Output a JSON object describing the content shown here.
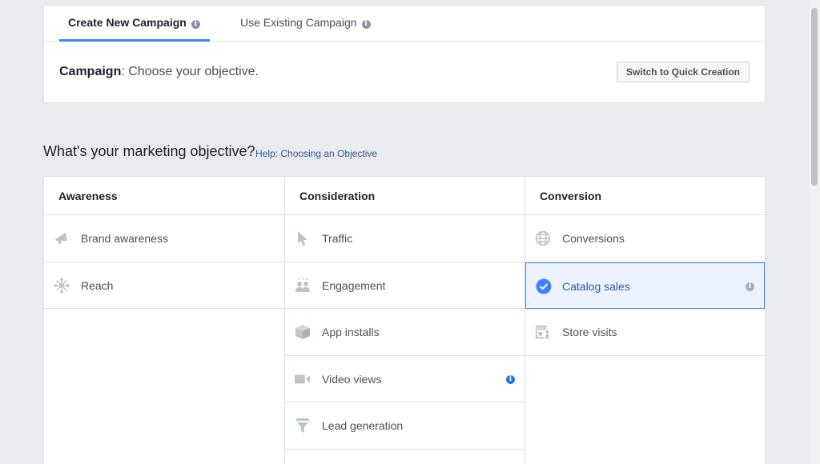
{
  "tabs": {
    "create_new": "Create New Campaign",
    "use_existing": "Use Existing Campaign"
  },
  "campaign": {
    "label": "Campaign",
    "text": ": Choose your objective.",
    "quick_creation_button": "Switch to Quick Creation"
  },
  "objective": {
    "title": "What's your marketing objective?",
    "help_link": "Help: Choosing an Objective"
  },
  "columns": [
    {
      "title": "Awareness",
      "items": [
        {
          "label": "Brand awareness",
          "icon": "megaphone-icon"
        },
        {
          "label": "Reach",
          "icon": "reach-icon"
        }
      ]
    },
    {
      "title": "Consideration",
      "items": [
        {
          "label": "Traffic",
          "icon": "cursor-icon"
        },
        {
          "label": "Engagement",
          "icon": "people-icon"
        },
        {
          "label": "App installs",
          "icon": "box-icon"
        },
        {
          "label": "Video views",
          "icon": "video-camera-icon"
        },
        {
          "label": "Lead generation",
          "icon": "funnel-icon"
        }
      ]
    },
    {
      "title": "Conversion",
      "items": [
        {
          "label": "Conversions",
          "icon": "globe-icon"
        },
        {
          "label": "Catalog sales",
          "icon": "check-circle-icon",
          "selected": true
        },
        {
          "label": "Store visits",
          "icon": "store-icon"
        }
      ]
    }
  ],
  "colors": {
    "accent": "#4080ff",
    "link": "#365899",
    "icon_grey": "#bec3c9"
  }
}
